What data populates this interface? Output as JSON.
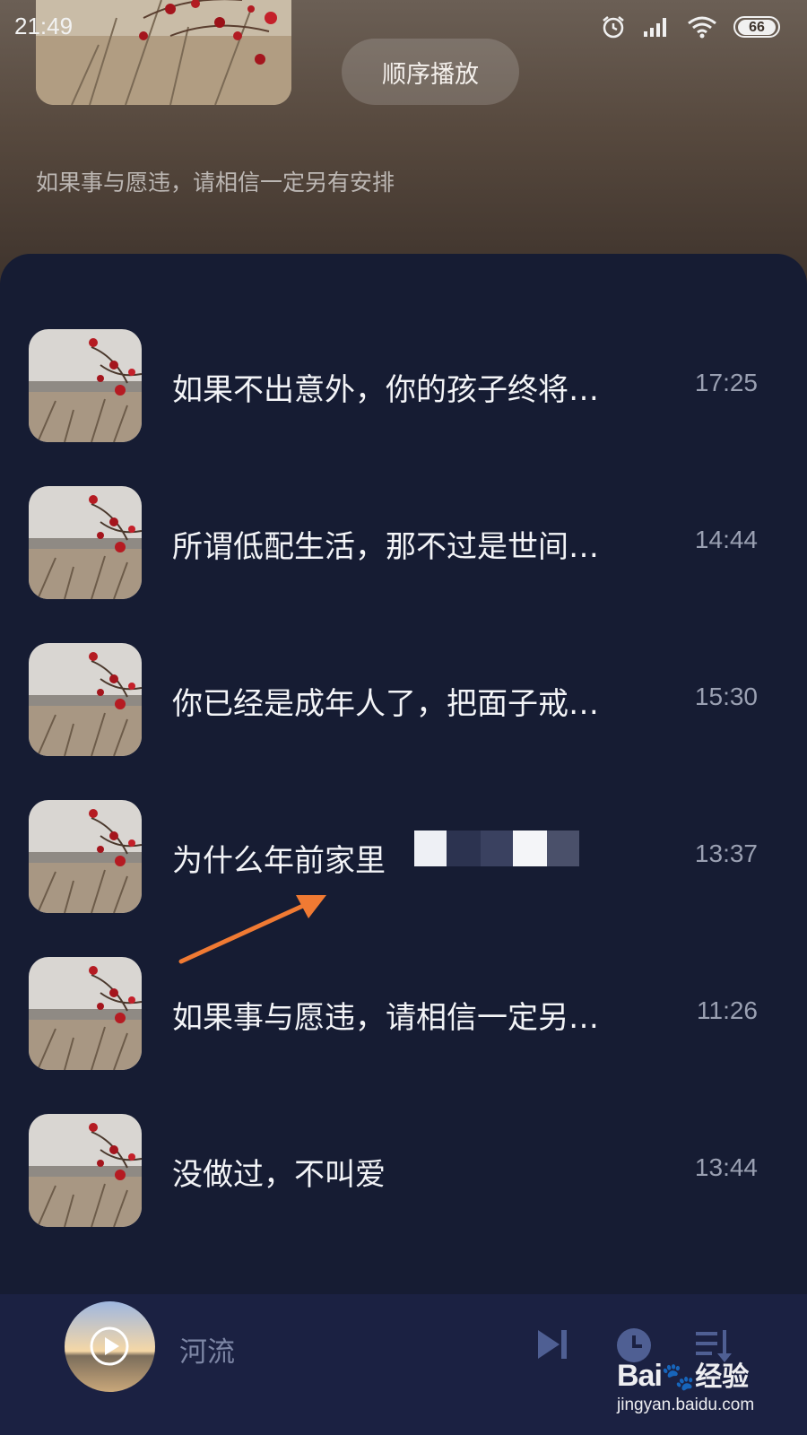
{
  "status_bar": {
    "time": "21:49",
    "battery": "66"
  },
  "header": {
    "play_order_label": "顺序播放",
    "subtitle": "如果事与愿违，请相信一定另有安排"
  },
  "tracks": [
    {
      "title": "如果不出意外，你的孩子终将…",
      "duration": "17:25"
    },
    {
      "title": "所谓低配生活，那不过是世间…",
      "duration": "14:44"
    },
    {
      "title": "你已经是成年人了，把面子戒…",
      "duration": "15:30"
    },
    {
      "title": "为什么年前家里",
      "duration": "13:37"
    },
    {
      "title": "如果事与愿违，请相信一定另…",
      "duration": "11:26"
    },
    {
      "title": "没做过，不叫爱",
      "duration": "13:44"
    }
  ],
  "player": {
    "title": "河流"
  },
  "watermark": {
    "logo": "Bai",
    "cn": "经验",
    "url": "jingyan.baidu.com"
  },
  "icons": {
    "alarm": "alarm-icon",
    "signal": "signal-icon",
    "wifi": "wifi-icon",
    "next": "skip-next-icon",
    "timer": "clock-icon",
    "playlist": "playlist-icon",
    "play": "play-icon",
    "arrow": "annotation-arrow"
  },
  "colors": {
    "panel_bg": "#161c33",
    "player_bg": "#1b2142",
    "annotation": "#f07a33",
    "player_icon": "#4f5f93"
  }
}
